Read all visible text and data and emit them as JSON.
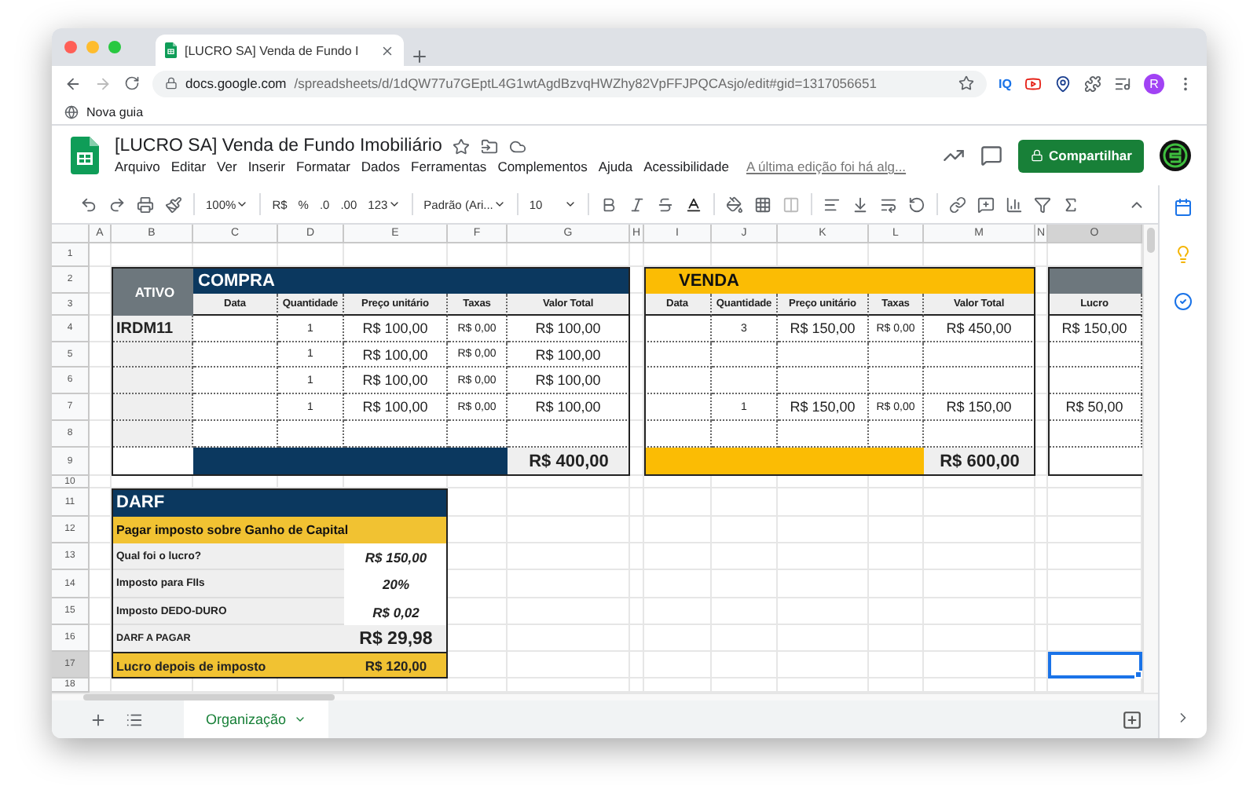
{
  "browser": {
    "tab_title": "[LUCRO SA] Venda de Fundo I",
    "url_host": "docs.google.com",
    "url_path": "/spreadsheets/d/1dQW77u7GEptL4G1wtAgdBzvqHWZhy82VpFFJPQCAsjo/edit#gid=1317056651",
    "extension_label": "IQ",
    "profile_initial": "R",
    "bookmark": "Nova guia"
  },
  "doc": {
    "title": "[LUCRO SA] Venda de Fundo Imobiliário",
    "menu": [
      "Arquivo",
      "Editar",
      "Ver",
      "Inserir",
      "Formatar",
      "Dados",
      "Ferramentas",
      "Complementos",
      "Ajuda",
      "Acessibilidade"
    ],
    "last_edit": "A última edição foi há alg...",
    "share": "Compartilhar"
  },
  "toolbar": {
    "zoom": "100%",
    "currency": "R$",
    "percent": "%",
    "decimal_less": ".0",
    "decimal_more": ".00",
    "number_format": "123",
    "font": "Padrão (Ari...",
    "font_size": "10"
  },
  "sheet": {
    "columns": [
      {
        "label": "A",
        "selected": false
      },
      {
        "label": "B",
        "selected": false
      },
      {
        "label": "C",
        "selected": false
      },
      {
        "label": "D",
        "selected": false
      },
      {
        "label": "E",
        "selected": false
      },
      {
        "label": "F",
        "selected": false
      },
      {
        "label": "G",
        "selected": false
      },
      {
        "label": "H",
        "selected": false
      },
      {
        "label": "I",
        "selected": false
      },
      {
        "label": "J",
        "selected": false
      },
      {
        "label": "K",
        "selected": false
      },
      {
        "label": "L",
        "selected": false
      },
      {
        "label": "M",
        "selected": false
      },
      {
        "label": "N",
        "selected": false
      },
      {
        "label": "O",
        "selected": true
      }
    ],
    "rows": [
      {
        "label": "1",
        "selected": false
      },
      {
        "label": "2",
        "selected": false
      },
      {
        "label": "3",
        "selected": false
      },
      {
        "label": "4",
        "selected": false
      },
      {
        "label": "5",
        "selected": false
      },
      {
        "label": "6",
        "selected": false
      },
      {
        "label": "7",
        "selected": false
      },
      {
        "label": "8",
        "selected": false
      },
      {
        "label": "9",
        "selected": false
      },
      {
        "label": "10",
        "selected": false
      },
      {
        "label": "11",
        "selected": false
      },
      {
        "label": "12",
        "selected": false
      },
      {
        "label": "13",
        "selected": false
      },
      {
        "label": "14",
        "selected": false
      },
      {
        "label": "15",
        "selected": false
      },
      {
        "label": "16",
        "selected": false
      },
      {
        "label": "17",
        "selected": true
      },
      {
        "label": "18",
        "selected": false
      }
    ],
    "compra": {
      "asset_header": "ATIVO",
      "title": "COMPRA",
      "asset": "IRDM11",
      "headers": [
        "Data",
        "Quantidade",
        "Preço unitário",
        "Taxas",
        "Valor Total"
      ],
      "rows": [
        {
          "quantity": "1",
          "price": "R$ 100,00",
          "fees": "R$ 0,00",
          "total": "R$ 100,00"
        },
        {
          "quantity": "1",
          "price": "R$ 100,00",
          "fees": "R$ 0,00",
          "total": "R$ 100,00"
        },
        {
          "quantity": "1",
          "price": "R$ 100,00",
          "fees": "R$ 0,00",
          "total": "R$ 100,00"
        },
        {
          "quantity": "1",
          "price": "R$ 100,00",
          "fees": "R$ 0,00",
          "total": "R$ 100,00"
        },
        {}
      ],
      "total": "R$ 400,00"
    },
    "venda": {
      "title": "VENDA",
      "headers": [
        "Data",
        "Quantidade",
        "Preço unitário",
        "Taxas",
        "Valor Total"
      ],
      "rows": [
        {
          "quantity": "3",
          "price": "R$ 150,00",
          "fees": "R$ 0,00",
          "total": "R$ 450,00"
        },
        {},
        {},
        {
          "quantity": "1",
          "price": "R$ 150,00",
          "fees": "R$ 0,00",
          "total": "R$ 150,00"
        },
        {}
      ],
      "total": "R$ 600,00"
    },
    "lucro": {
      "header": "Lucro",
      "rows": [
        "R$ 150,00",
        null,
        null,
        "R$ 50,00",
        null
      ]
    },
    "darf": {
      "title": "DARF",
      "subtitle": "Pagar imposto sobre Ganho de Capital",
      "rows": [
        {
          "label": "Qual foi o lucro?",
          "value": "R$ 150,00",
          "kind": "italic"
        },
        {
          "label": "Imposto para FIIs",
          "value": "20%",
          "kind": "italic"
        },
        {
          "label": "Imposto DEDO-DURO",
          "value": "R$ 0,02",
          "kind": "italic"
        },
        {
          "label": "DARF A PAGAR",
          "value": "R$ 29,98",
          "kind": "emphasis"
        },
        {
          "label": "Lucro depois de imposto",
          "value": "R$ 120,00",
          "kind": "highlight"
        }
      ]
    }
  },
  "sheet_tabs": [
    {
      "label": "Organização",
      "selected": true
    }
  ]
}
